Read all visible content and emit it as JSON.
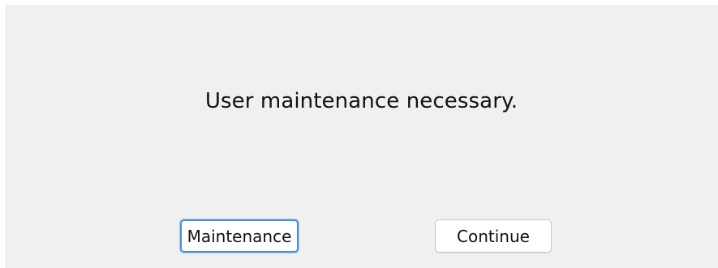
{
  "dialog": {
    "message": "User maintenance necessary.",
    "buttons": {
      "maintenance_label": "Maintenance",
      "continue_label": "Continue"
    }
  },
  "colors": {
    "dialog_background": "#f0f0f0",
    "default_button_border": "#4a90d9"
  }
}
